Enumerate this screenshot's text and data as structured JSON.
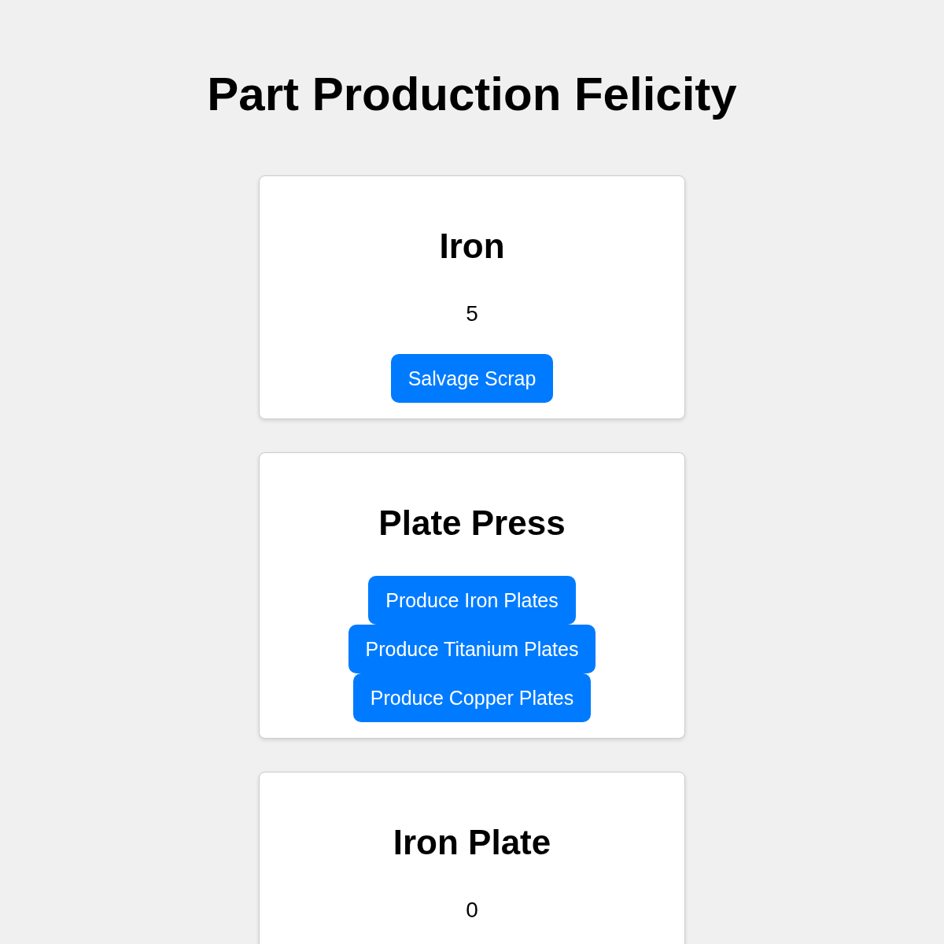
{
  "page": {
    "title": "Part Production Felicity"
  },
  "cards": [
    {
      "title": "Iron",
      "value": "5",
      "buttons": [
        "Salvage Scrap"
      ]
    },
    {
      "title": "Plate Press",
      "buttons": [
        "Produce Iron Plates",
        "Produce Titanium Plates",
        "Produce Copper Plates"
      ]
    },
    {
      "title": "Iron Plate",
      "value": "0"
    }
  ]
}
